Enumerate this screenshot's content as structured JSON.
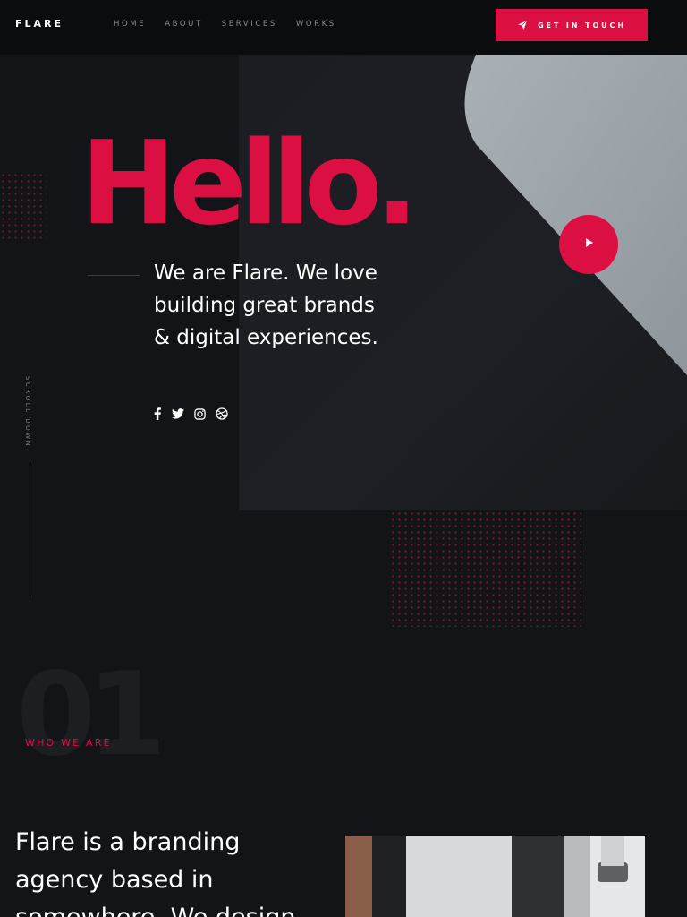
{
  "header": {
    "logo": "FLARE",
    "nav": [
      "HOME",
      "ABOUT",
      "SERVICES",
      "WORKS"
    ],
    "cta_label": "GET IN TOUCH",
    "cta_icon": "paper-plane-icon"
  },
  "hero": {
    "title": "Hello.",
    "lines": [
      "We are Flare. We love",
      "building great brands",
      "& digital experiences."
    ],
    "play_icon": "play-icon",
    "scroll_label": "SCROLL DOWN",
    "socials": [
      "facebook-icon",
      "twitter-icon",
      "instagram-icon",
      "dribbble-icon"
    ]
  },
  "about": {
    "number": "01",
    "label": "WHO WE ARE",
    "lines": [
      "Flare is a branding",
      "agency based in",
      "somewhere. We design"
    ]
  },
  "colors": {
    "accent": "#dc0f43",
    "background": "#121418",
    "header_background": "#0b0c0e"
  }
}
